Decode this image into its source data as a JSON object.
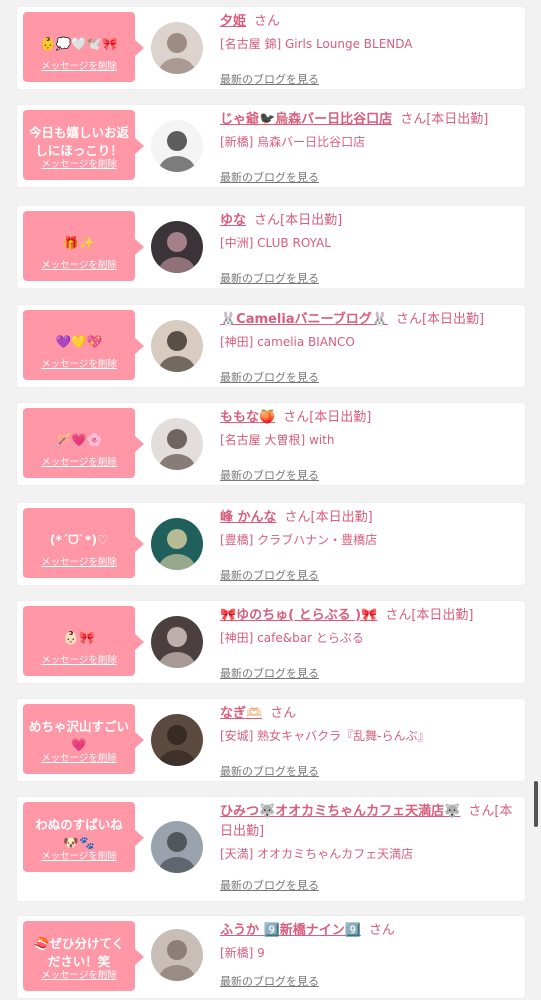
{
  "colors": {
    "bubble": "#ff97a6",
    "accent": "#d95d7d",
    "link_gray": "#777777",
    "page_bg": "#f2f2f2"
  },
  "cards": [
    {
      "message": "👶💭🤍🕊️🎀",
      "delete_label": "メッセージを削除",
      "name": "夕姫",
      "san": "さん",
      "status": "",
      "shop": "[名古屋 錦] Girls Lounge BLENDA",
      "blog_label": "最新のブログを見る",
      "avatar": {
        "bg": "#dcd3cf",
        "fg": "#8a746a"
      }
    },
    {
      "message": "今日も嬉しいお返しにほっこり！",
      "delete_label": "メッセージを削除",
      "name": "じゃ爺🐦‍⬛烏森バー日比谷口店",
      "san": "さん",
      "status": "[本日出勤]",
      "shop": "[新橋] 烏森バー日比谷口店",
      "blog_label": "最新のブログを見る",
      "avatar": {
        "bg": "#f4f4f4",
        "fg": "#2b2b2b"
      }
    },
    {
      "message": "🎁✨",
      "delete_label": "メッセージを削除",
      "name": "ゆな",
      "san": "さん",
      "status": "[本日出勤]",
      "shop": "[中洲] CLUB ROYAL",
      "blog_label": "最新のブログを見る",
      "avatar": {
        "bg": "#3a3338",
        "fg": "#c99aa5"
      }
    },
    {
      "message": "💜💛💖",
      "delete_label": "メッセージを削除",
      "name": "🐰Cameliaバニーブログ🐰",
      "san": "さん",
      "status": "[本日出勤]",
      "shop": "[神田] camelia BIANCO",
      "blog_label": "最新のブログを見る",
      "avatar": {
        "bg": "#d8ccc0",
        "fg": "#2e2620"
      }
    },
    {
      "message": "🪄💗🌸",
      "delete_label": "メッセージを削除",
      "name": "ももな🍑",
      "san": "さん",
      "status": "[本日出勤]",
      "shop": "[名古屋 大曽根] with",
      "blog_label": "最新のブログを見る",
      "avatar": {
        "bg": "#e3dedc",
        "fg": "#4a3b35"
      }
    },
    {
      "message": "(*ˊᗜˋ*)♡",
      "delete_label": "メッセージを削除",
      "name": "峰 かんな",
      "san": "さん",
      "status": "[本日出勤]",
      "shop": "[豊橋] クラブハナン・豊橋店",
      "blog_label": "最新のブログを見る",
      "avatar": {
        "bg": "#1f5f5c",
        "fg": "#e9d9a8"
      }
    },
    {
      "message": "👶🏻🎀",
      "delete_label": "メッセージを削除",
      "name": "🎀ゆのちゅ( とらぶる )🎀",
      "san": "さん",
      "status": "[本日出勤]",
      "shop": "[神田] cafe&bar とらぶる",
      "blog_label": "最新のブログを見る",
      "avatar": {
        "bg": "#4b3f40",
        "fg": "#e6d6d0"
      }
    },
    {
      "message": "めちゃ沢山すごい💗",
      "delete_label": "メッセージを削除",
      "name": "なぎ🫶🏻",
      "san": "さん",
      "status": "",
      "shop": "[安城] 熟女キャバクラ『乱舞-らんぶ』",
      "blog_label": "最新のブログを見る",
      "avatar": {
        "bg": "#5d4a3e",
        "fg": "#2a221d"
      }
    },
    {
      "message": "わぬのすばいね🐶🐾",
      "delete_label": "メッセージを削除",
      "name": "ひみつ🐺オオカミちゃんカフェ天満店🐺",
      "san": "さん",
      "status": "[本日出勤]",
      "shop": "[天満] オオカミちゃんカフェ天満店",
      "blog_label": "最新のブログを見る",
      "avatar": {
        "bg": "#9aa3ad",
        "fg": "#3a3d42"
      }
    },
    {
      "message": "🍣ぜひ分けてください！笑",
      "delete_label": "メッセージを削除",
      "name": "ふうか 9️⃣新橋ナイン9️⃣",
      "san": "さん",
      "status": "",
      "shop": "[新橋] 9",
      "blog_label": "最新のブログを見る",
      "avatar": {
        "bg": "#c9bdb8",
        "fg": "#7a6a64"
      }
    }
  ]
}
